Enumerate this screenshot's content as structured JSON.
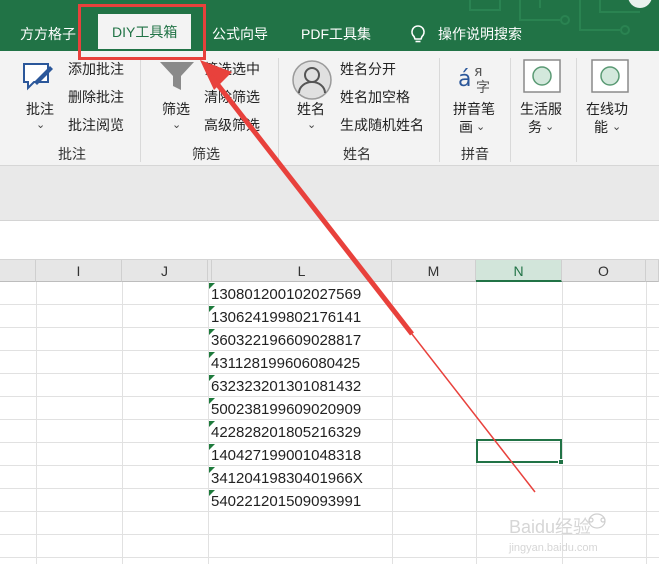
{
  "tabs": [
    {
      "label": "方方格子"
    },
    {
      "label": "DIY工具箱"
    },
    {
      "label": "公式向导"
    },
    {
      "label": "PDF工具集"
    },
    {
      "label": "操作说明搜索"
    }
  ],
  "ribbon": {
    "comment_group": {
      "main_label": "批注",
      "items": [
        "添加批注",
        "删除批注",
        "批注阅览"
      ],
      "group_label": "批注"
    },
    "filter_group": {
      "main_label": "筛选",
      "items": [
        "筛选选中",
        "清除筛选",
        "高级筛选"
      ],
      "group_label": "筛选"
    },
    "name_group": {
      "main_label": "姓名",
      "items": [
        "姓名分开",
        "姓名加空格",
        "生成随机姓名"
      ],
      "group_label": "姓名"
    },
    "pinyin_group": {
      "main_label_line1": "拼音笔",
      "main_label_line2": "画",
      "group_label": "拼音"
    },
    "life_service": {
      "line1": "生活服",
      "line2": "务"
    },
    "online": {
      "line1": "在线功",
      "line2": "能"
    }
  },
  "columns": [
    {
      "label": "I"
    },
    {
      "label": "J"
    },
    {
      "label": "L"
    },
    {
      "label": "M"
    },
    {
      "label": "N"
    },
    {
      "label": "O"
    }
  ],
  "cells": [
    "130801200102027569",
    "130624199802176141",
    "360322196609028817",
    "431128199606080425",
    "632323201301081432",
    "500238199609020909",
    "422828201805216329",
    "140427199001048318",
    "34120419830401966X",
    "540221201509093991"
  ],
  "watermark": {
    "text": "Baidu经验",
    "sub": "jingyan.baidu.com"
  },
  "colors": {
    "accent": "#217346",
    "annotation": "#e8413c"
  }
}
